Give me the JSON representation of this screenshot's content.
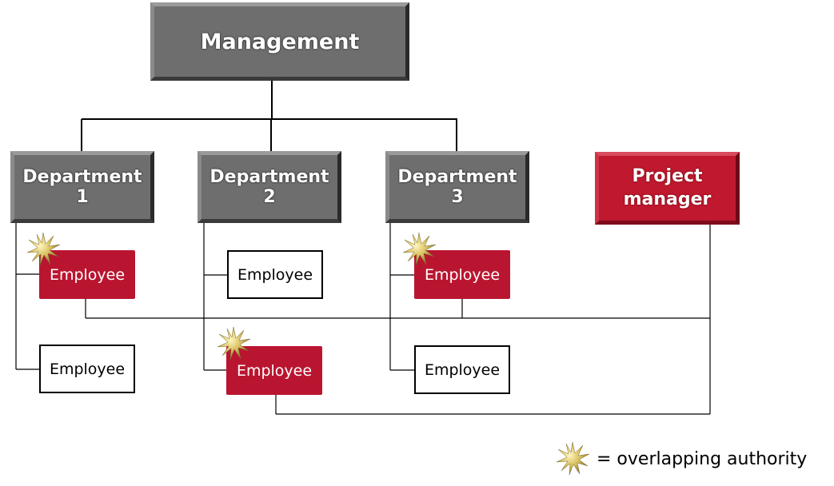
{
  "diagram": {
    "management": {
      "label": "Management"
    },
    "departments": [
      {
        "label": "Department 1"
      },
      {
        "label": "Department 2"
      },
      {
        "label": "Department 3"
      }
    ],
    "project_manager": {
      "label": "Project manager"
    },
    "employees": [
      {
        "label": "Employee",
        "department": "Department 1",
        "overlapping_authority": true
      },
      {
        "label": "Employee",
        "department": "Department 1",
        "overlapping_authority": false
      },
      {
        "label": "Employee",
        "department": "Department 2",
        "overlapping_authority": false
      },
      {
        "label": "Employee",
        "department": "Department 2",
        "overlapping_authority": true
      },
      {
        "label": "Employee",
        "department": "Department 3",
        "overlapping_authority": true
      },
      {
        "label": "Employee",
        "department": "Department 3",
        "overlapping_authority": false
      }
    ],
    "legend": {
      "icon": "star-burst-icon",
      "text": "= overlapping authority"
    },
    "colors": {
      "gray_box": "#6e6e6e",
      "red_box": "#c0182f",
      "line": "#000000"
    }
  }
}
